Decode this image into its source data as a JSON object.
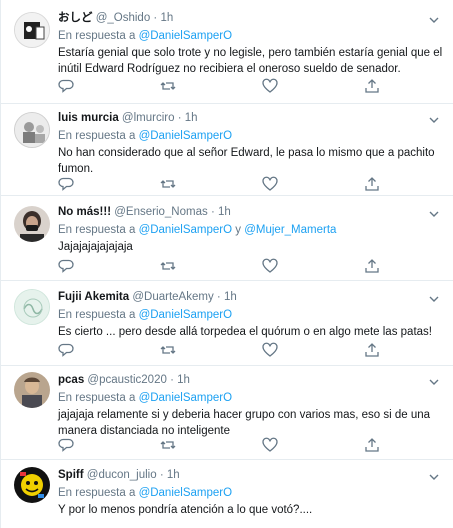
{
  "feed": {
    "reply_prefix": "En respuesta a",
    "connector": "y",
    "tweets": [
      {
        "name": "おしど",
        "handle": "@_Oshido",
        "sep": "·",
        "time": "1h",
        "mentions": [
          "@DanielSamperO"
        ],
        "text": "Estaría genial que solo trote y no legisle, pero también estaría genial que el inútil Edward Rodríguez no recibiera el oneroso sueldo de senador."
      },
      {
        "name": "luis murcia",
        "handle": "@lmurciro",
        "sep": "·",
        "time": "1h",
        "mentions": [
          "@DanielSamperO"
        ],
        "text": "No han considerado que al señor Edward, le pasa lo mismo que a pachito fumon."
      },
      {
        "name": "No más!!!",
        "handle": "@Enserio_Nomas",
        "sep": "·",
        "time": "1h",
        "mentions": [
          "@DanielSamperO",
          "@Mujer_Mamerta"
        ],
        "text": "Jajajajajajajaja"
      },
      {
        "name": "Fujii Akemita",
        "handle": "@DuarteAkemy",
        "sep": "·",
        "time": "1h",
        "mentions": [
          "@DanielSamperO"
        ],
        "text": "Es cierto ... pero desde allá torpedea el quórum o en algo mete las patas!"
      },
      {
        "name": "pcas",
        "handle": "@pcaustic2020",
        "sep": "·",
        "time": "1h",
        "mentions": [
          "@DanielSamperO"
        ],
        "text": "jajajaja relamente si y deberia hacer grupo con varios mas, eso si de una manera distanciada no inteligente"
      },
      {
        "name": "Spiff",
        "handle": "@ducon_julio",
        "sep": "·",
        "time": "1h",
        "mentions": [
          "@DanielSamperO"
        ],
        "text": "Y por lo menos pondría atención a lo que votó?...."
      }
    ]
  },
  "colors": {
    "accent": "#1da1f2",
    "muted": "#657786",
    "text": "#14171a",
    "divider": "#e6ecf0"
  },
  "icons": [
    "reply-icon",
    "retweet-icon",
    "like-icon",
    "share-icon",
    "caret-down-icon"
  ]
}
